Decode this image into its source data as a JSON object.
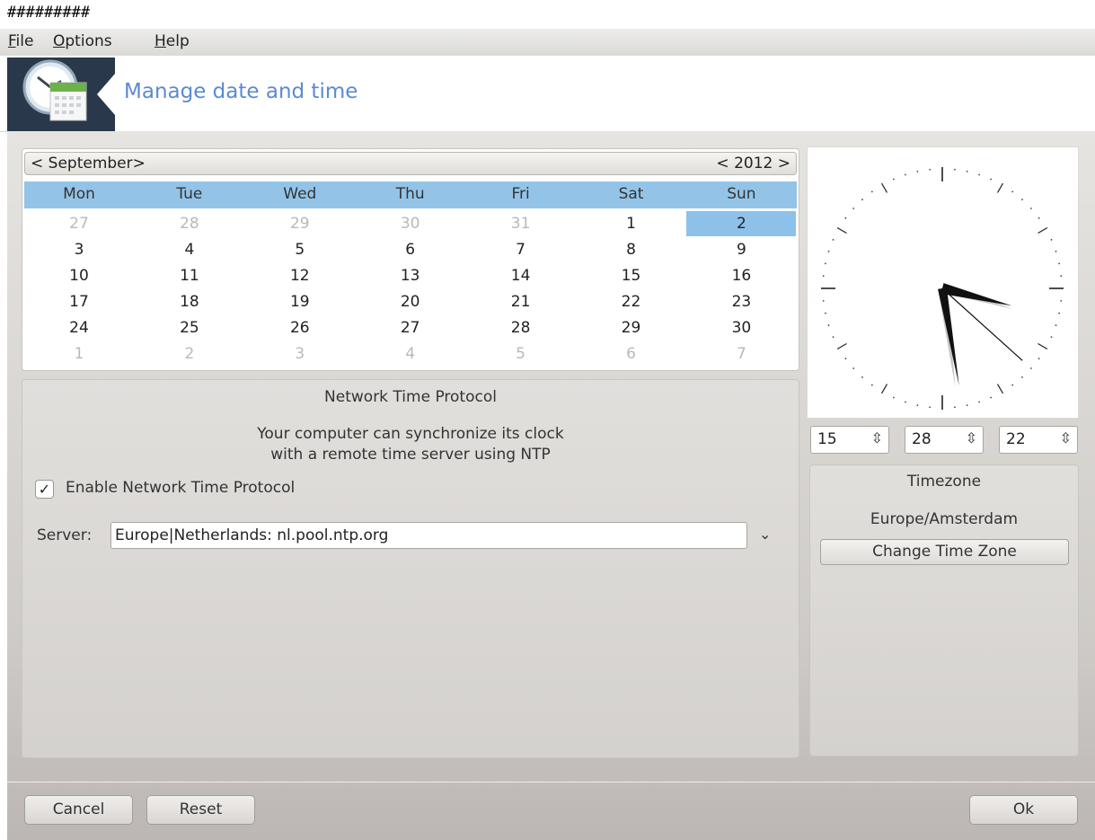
{
  "window": {
    "title": "#########"
  },
  "menubar": {
    "items": [
      {
        "label": "File",
        "mnemonic": "F",
        "rest": "ile"
      },
      {
        "label": "Options",
        "mnemonic": "O",
        "rest": "ptions"
      },
      {
        "label": "Help",
        "mnemonic": "H",
        "rest": "elp"
      }
    ]
  },
  "header": {
    "title": "Manage date and time",
    "icon": "clock-calendar-icon",
    "title_color": "#5a8bd1"
  },
  "calendar": {
    "month": "September",
    "year": "2012",
    "prev_month": "<",
    "next_month": ">",
    "prev_year": "<",
    "next_year": ">",
    "weekdays": [
      "Mon",
      "Tue",
      "Wed",
      "Thu",
      "Fri",
      "Sat",
      "Sun"
    ],
    "selected_day": "2",
    "weeks": [
      [
        {
          "d": "27",
          "dim": true
        },
        {
          "d": "28",
          "dim": true
        },
        {
          "d": "29",
          "dim": true
        },
        {
          "d": "30",
          "dim": true
        },
        {
          "d": "31",
          "dim": true
        },
        {
          "d": "1",
          "dim": false
        },
        {
          "d": "2",
          "dim": false,
          "sel": true
        }
      ],
      [
        {
          "d": "3"
        },
        {
          "d": "4"
        },
        {
          "d": "5"
        },
        {
          "d": "6"
        },
        {
          "d": "7"
        },
        {
          "d": "8"
        },
        {
          "d": "9"
        }
      ],
      [
        {
          "d": "10"
        },
        {
          "d": "11"
        },
        {
          "d": "12"
        },
        {
          "d": "13"
        },
        {
          "d": "14"
        },
        {
          "d": "15"
        },
        {
          "d": "16"
        }
      ],
      [
        {
          "d": "17"
        },
        {
          "d": "18"
        },
        {
          "d": "19"
        },
        {
          "d": "20"
        },
        {
          "d": "21"
        },
        {
          "d": "22"
        },
        {
          "d": "23"
        }
      ],
      [
        {
          "d": "24"
        },
        {
          "d": "25"
        },
        {
          "d": "26"
        },
        {
          "d": "27"
        },
        {
          "d": "28"
        },
        {
          "d": "29"
        },
        {
          "d": "30"
        }
      ],
      [
        {
          "d": "1",
          "dim": true
        },
        {
          "d": "2",
          "dim": true
        },
        {
          "d": "3",
          "dim": true
        },
        {
          "d": "4",
          "dim": true
        },
        {
          "d": "5",
          "dim": true
        },
        {
          "d": "6",
          "dim": true
        },
        {
          "d": "7",
          "dim": true
        }
      ]
    ],
    "header_color": "#93c4e8"
  },
  "ntp": {
    "title": "Network Time Protocol",
    "description_line1": "Your computer can synchronize its clock",
    "description_line2": "with a remote time server using NTP",
    "enable_label": "Enable Network Time Protocol",
    "enabled": true,
    "check_mark": "✓",
    "server_label": "Server:",
    "server_value": "Europe|Netherlands: nl.pool.ntp.org",
    "dropdown_icon": "⌄"
  },
  "clock": {
    "hours": 15,
    "minutes": 28,
    "seconds": 22
  },
  "time_spinners": {
    "hour": "15",
    "minute": "28",
    "second": "22",
    "arrow_icon": "⇳"
  },
  "timezone": {
    "title": "Timezone",
    "value": "Europe/Amsterdam",
    "change_button": "Change Time Zone"
  },
  "footer": {
    "cancel": "Cancel",
    "reset": "Reset",
    "ok": "Ok"
  }
}
